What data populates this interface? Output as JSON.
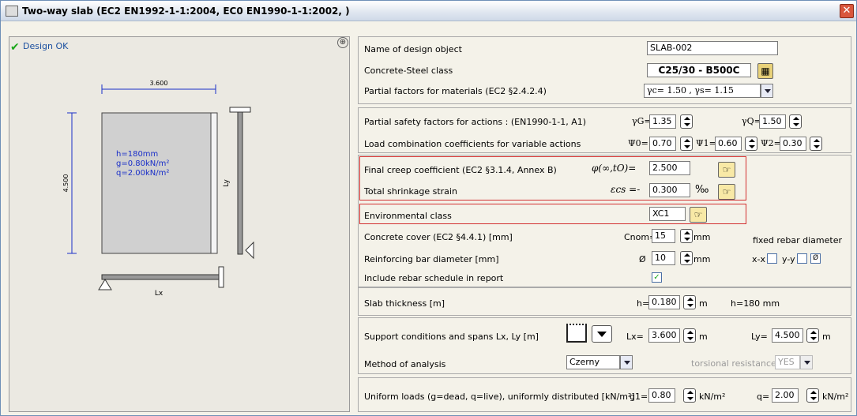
{
  "window": {
    "title": "Two-way slab (EC2 EN1992-1-1:2004, EC0 EN1990-1-1:2002, )",
    "close": "✕"
  },
  "left": {
    "status": "Design OK",
    "zoom": "⊕",
    "sketch": {
      "lx_dim": "3.600",
      "ly_dim": "4.500",
      "props": [
        "h=180mm",
        "g=0.80kN/m²",
        "q=2.00kN/m²"
      ],
      "lx": "Lx",
      "ly": "Ly"
    }
  },
  "form": {
    "name_label": "Name of design object",
    "name_value": "SLAB-002",
    "class_label": "Concrete-Steel class",
    "class_value": "C25/30 - B500C",
    "pf_mat_label": "Partial factors for materials (EC2 §2.4.2.4)",
    "pf_mat_value": "γc= 1.50 , γs= 1.15",
    "pf_act_label": "Partial safety factors for actions : (EN1990-1-1, A1)",
    "gG_label": "γG=",
    "gG_value": "1.35",
    "gQ_label": "γQ=",
    "gQ_value": "1.50",
    "psi_label": "Load combination coefficients for variable actions",
    "psi0_label": "Ψ0=",
    "psi0_value": "0.70",
    "psi1_label": "Ψ1=",
    "psi1_value": "0.60",
    "psi2_label": "Ψ2=",
    "psi2_value": "0.30",
    "creep_label": "Final creep coefficient (EC2 §3.1.4, Annex B)",
    "creep_sym": "φ(∞,tO)=",
    "creep_value": "2.500",
    "shrink_label": "Total shrinkage strain",
    "shrink_sym": "εcs =-",
    "shrink_value": "0.300",
    "shrink_unit": "‰",
    "env_label": "Environmental class",
    "env_value": "XC1",
    "cover_label": "Concrete cover (EC2 §4.4.1) [mm]",
    "cover_sym": "Cnom=",
    "cover_value": "15",
    "cover_unit": "mm",
    "fixed_label": "fixed rebar diameter",
    "bar_label": "Reinforcing bar diameter [mm]",
    "bar_sym": "Ø",
    "bar_value": "10",
    "bar_unit": "mm",
    "xx_label": "x-x",
    "yy_label": "y-y",
    "phi_icon": "Ø",
    "sched_label": "Include rebar schedule in report",
    "sched_check": "✓",
    "thick_label": "Slab thickness [m]",
    "h_label": "h=",
    "h_value": "0.180",
    "h_unit": "m",
    "h_note": "h=180 mm",
    "support_label": "Support conditions and spans Lx, Ly [m]",
    "lx_label": "Lx=",
    "lx_value": "3.600",
    "lx_unit": "m",
    "ly_label": "Ly=",
    "ly_value": "4.500",
    "ly_unit": "m",
    "method_label": "Method of analysis",
    "method_value": "Czerny",
    "tors_label": "torsional resistance",
    "tors_value": "YES",
    "loads_label": "Uniform loads (g=dead, q=live), uniformly distributed [kN/m²]",
    "g1_label": "g1=",
    "g1_value": "0.80",
    "g1_unit": "kN/m²",
    "q_label": "q=",
    "q_value": "2.00",
    "q_unit": "kN/m²"
  }
}
